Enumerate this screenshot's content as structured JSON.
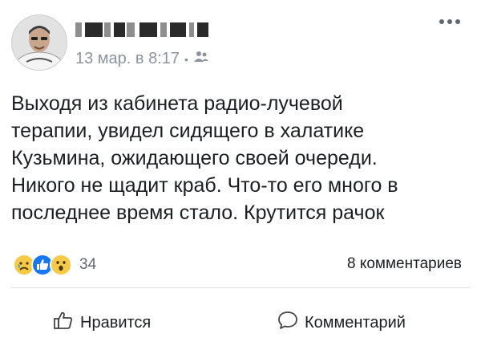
{
  "post": {
    "timestamp": "13 мар. в 8:17",
    "separator": "•",
    "audience_icon": "friends-icon",
    "more_icon": "more-horizontal-icon",
    "text": "Выходя из кабинета радио-лучевой\nтерапии, увидел сидящего в халатике\nКузьмина, ожидающего своей очереди.\nНикого не щадит краб. Что-то его много в\nпоследнее время стало. Крутится рачок",
    "reactions": {
      "icons": [
        "sad-reaction-icon",
        "like-reaction-icon",
        "wow-reaction-icon"
      ],
      "count": "34"
    },
    "comments_count": "8 комментариев",
    "actions": {
      "like_label": "Нравится",
      "like_icon": "thumbs-up-icon",
      "comment_label": "Комментарий",
      "comment_icon": "speech-bubble-icon"
    },
    "colors": {
      "meta": "#8d949e",
      "text": "#1c1e21",
      "like_reaction": "#1877f2",
      "emoji": "#f7c948"
    }
  }
}
